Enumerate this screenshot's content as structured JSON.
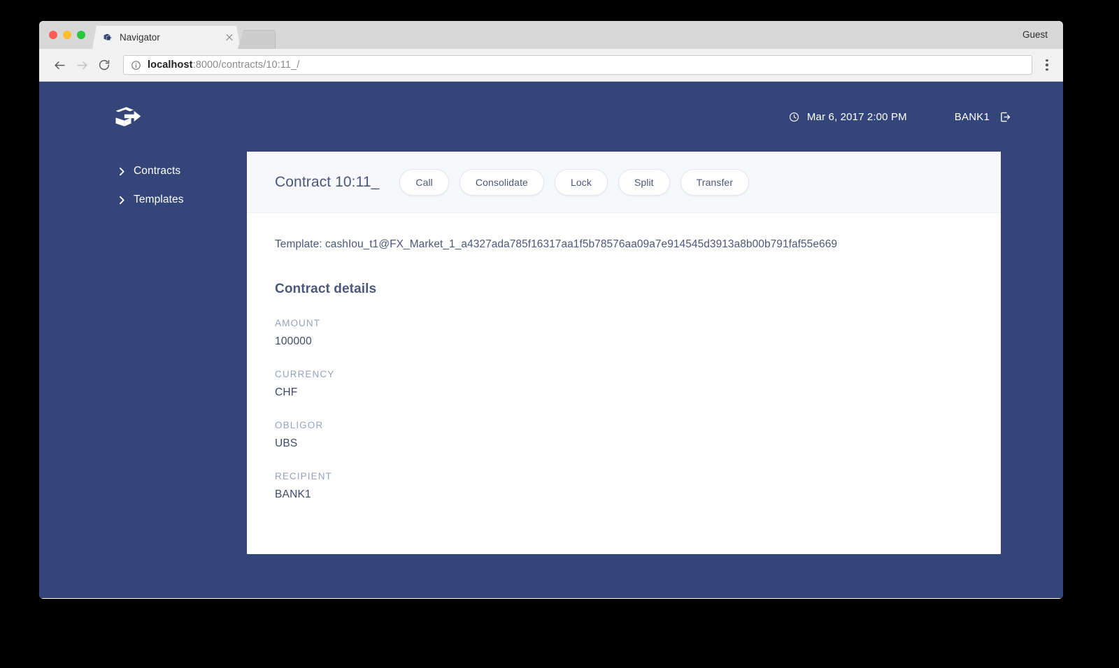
{
  "browser": {
    "tab": {
      "title": "Navigator",
      "favicon_icon": "navigator-cube-icon",
      "close_icon": "close-icon"
    },
    "new_tab_icon": "new-tab-icon",
    "profile_label": "Guest",
    "back_icon": "back-arrow-icon",
    "forward_icon": "forward-arrow-icon",
    "reload_icon": "reload-icon",
    "omnibox": {
      "info_icon": "info-circle-icon",
      "url_host": "localhost",
      "url_rest": ":8000/contracts/10:11_/",
      "full_url": "localhost:8000/contracts/10:11_/"
    },
    "menu_icon": "kebab-menu-icon"
  },
  "app": {
    "logo_icon": "daml-navigator-logo",
    "clock_icon": "clock-icon",
    "datetime": "Mar 6, 2017 2:00 PM",
    "username": "BANK1",
    "logout_icon": "logout-icon"
  },
  "sidebar": {
    "items": [
      {
        "label": "Contracts",
        "icon": "chevron-right-icon"
      },
      {
        "label": "Templates",
        "icon": "chevron-right-icon"
      }
    ]
  },
  "contract": {
    "title": "Contract 10:11_",
    "actions": [
      {
        "label": "Call"
      },
      {
        "label": "Consolidate"
      },
      {
        "label": "Lock"
      },
      {
        "label": "Split"
      },
      {
        "label": "Transfer"
      }
    ],
    "template_line": "Template: cashIou_t1@FX_Market_1_a4327ada785f16317aa1f5b78576aa09a7e914545d3913a8b00b791faf55e669",
    "details_heading": "Contract details",
    "details": [
      {
        "label": "AMOUNT",
        "value": "100000"
      },
      {
        "label": "CURRENCY",
        "value": "CHF"
      },
      {
        "label": "OBLIGOR",
        "value": "UBS"
      },
      {
        "label": "RECIPIENT",
        "value": "BANK1"
      }
    ]
  },
  "colors": {
    "app_background": "#344579",
    "card_background": "#ffffff",
    "card_header": "#f6f8fc",
    "text_primary": "#4c5878",
    "label_muted": "#96a2c0",
    "chrome_tabstrip": "#d8d8d8",
    "chrome_toolbar": "#f2f2f2"
  }
}
